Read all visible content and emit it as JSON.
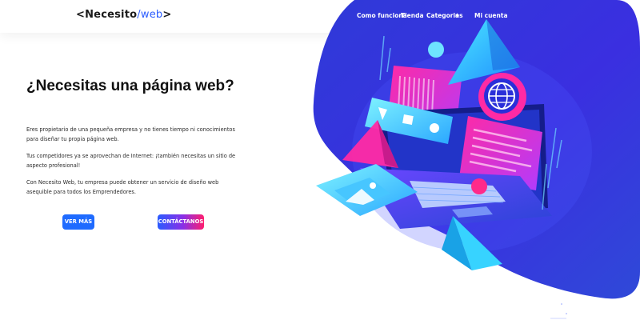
{
  "header": {
    "logo": {
      "prefix": "<Necesito",
      "slash": "/",
      "suffix": "web",
      "suffix_end": ">"
    },
    "nav": {
      "items": [
        {
          "label": "Como funciona"
        },
        {
          "label": "Tienda"
        },
        {
          "label": "Categorias"
        },
        {
          "label": "Mi cuenta"
        }
      ],
      "categorias_plus": "+"
    }
  },
  "hero": {
    "title": "¿Necesitas una página web?",
    "paragraphs": [
      "Eres propietario de una pequeña empresa y no tienes tiempo ni conocimientos para diseñar tu propia página web.",
      "Tus competidores ya se aprovechan de Internet: ¡también necesitas un sitio de aspecto profesional!",
      "Con Necesito Web, tu empresa puede obtener un servicio de diseño web asequible para todos los Emprendedores."
    ],
    "buttons": {
      "ver_mas": "VER MÁS",
      "contactanos": "CONTÁCTANOS"
    }
  },
  "colors": {
    "accent_blue": "#1f6bff",
    "blob_blue": "#3433d6",
    "gradient_pink": "#ff1e6e",
    "gradient_purple": "#8a2fe6"
  },
  "icons": {
    "illustration": "laptop-web-design-illustration",
    "globe": "globe-icon",
    "image": "image-icon"
  }
}
